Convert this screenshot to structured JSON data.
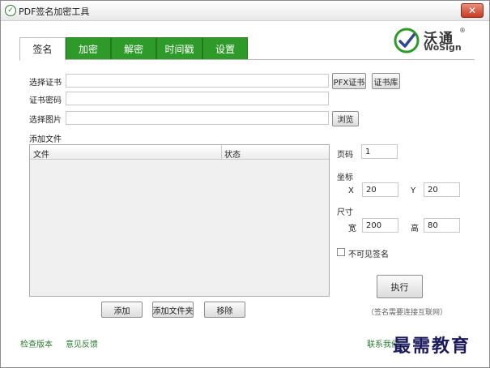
{
  "window": {
    "title": "PDF签名加密工具",
    "close_glyph": "✕"
  },
  "brand": {
    "name_cn": "沃通",
    "name_en": "WoSign",
    "reg_mark": "®",
    "accent": "#2e9a2a"
  },
  "tabs": [
    {
      "label": "签名",
      "active": true
    },
    {
      "label": "加密",
      "active": false
    },
    {
      "label": "解密",
      "active": false
    },
    {
      "label": "时间戳",
      "active": false
    },
    {
      "label": "设置",
      "active": false
    }
  ],
  "form": {
    "cert_label": "选择证书",
    "cert_value": "",
    "pfx_button": "PFX证书",
    "certstore_button": "证书库",
    "password_label": "证书密码",
    "password_value": "",
    "image_label": "选择图片",
    "image_value": "",
    "browse_button": "浏览"
  },
  "files": {
    "section_label": "添加文件",
    "columns": [
      "文件",
      "状态"
    ],
    "rows": [],
    "add_button": "添加",
    "add_folder_button": "添加文件夹",
    "remove_button": "移除"
  },
  "position": {
    "page_label": "页码",
    "page_value": "1",
    "coord_label": "坐标",
    "x_label": "X",
    "x_value": "20",
    "y_label": "Y",
    "y_value": "20",
    "size_label": "尺寸",
    "width_label": "宽",
    "width_value": "200",
    "height_label": "高",
    "height_value": "80",
    "invisible_label": "不可见签名",
    "invisible_checked": false,
    "execute_button": "执行",
    "note": "（签名需要连接互联网）"
  },
  "footer": {
    "check_version": "检查版本",
    "feedback": "意见反馈",
    "contact_us": "联系我们",
    "watermark": "最需教育"
  }
}
